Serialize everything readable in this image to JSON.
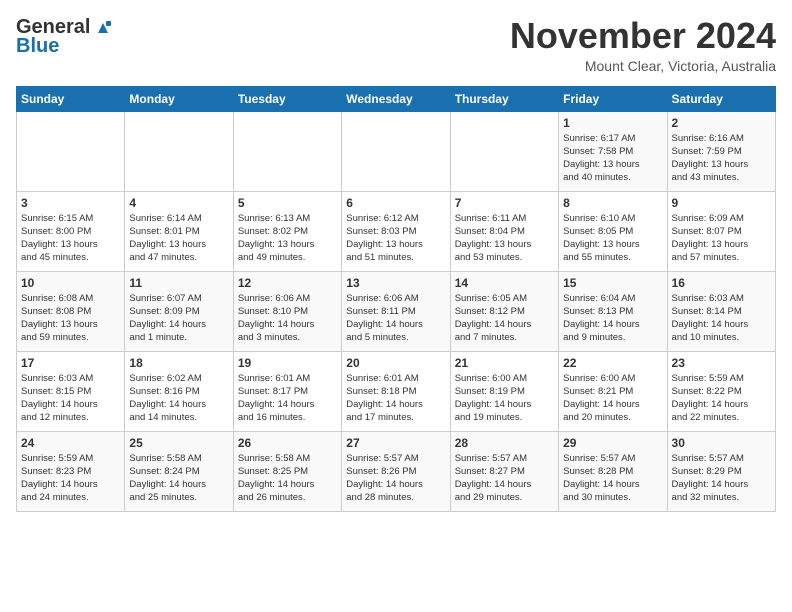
{
  "header": {
    "logo_line1": "General",
    "logo_line2": "Blue",
    "calendar_title": "November 2024",
    "calendar_subtitle": "Mount Clear, Victoria, Australia"
  },
  "weekdays": [
    "Sunday",
    "Monday",
    "Tuesday",
    "Wednesday",
    "Thursday",
    "Friday",
    "Saturday"
  ],
  "weeks": [
    [
      {
        "day": "",
        "info": ""
      },
      {
        "day": "",
        "info": ""
      },
      {
        "day": "",
        "info": ""
      },
      {
        "day": "",
        "info": ""
      },
      {
        "day": "",
        "info": ""
      },
      {
        "day": "1",
        "info": "Sunrise: 6:17 AM\nSunset: 7:58 PM\nDaylight: 13 hours\nand 40 minutes."
      },
      {
        "day": "2",
        "info": "Sunrise: 6:16 AM\nSunset: 7:59 PM\nDaylight: 13 hours\nand 43 minutes."
      }
    ],
    [
      {
        "day": "3",
        "info": "Sunrise: 6:15 AM\nSunset: 8:00 PM\nDaylight: 13 hours\nand 45 minutes."
      },
      {
        "day": "4",
        "info": "Sunrise: 6:14 AM\nSunset: 8:01 PM\nDaylight: 13 hours\nand 47 minutes."
      },
      {
        "day": "5",
        "info": "Sunrise: 6:13 AM\nSunset: 8:02 PM\nDaylight: 13 hours\nand 49 minutes."
      },
      {
        "day": "6",
        "info": "Sunrise: 6:12 AM\nSunset: 8:03 PM\nDaylight: 13 hours\nand 51 minutes."
      },
      {
        "day": "7",
        "info": "Sunrise: 6:11 AM\nSunset: 8:04 PM\nDaylight: 13 hours\nand 53 minutes."
      },
      {
        "day": "8",
        "info": "Sunrise: 6:10 AM\nSunset: 8:05 PM\nDaylight: 13 hours\nand 55 minutes."
      },
      {
        "day": "9",
        "info": "Sunrise: 6:09 AM\nSunset: 8:07 PM\nDaylight: 13 hours\nand 57 minutes."
      }
    ],
    [
      {
        "day": "10",
        "info": "Sunrise: 6:08 AM\nSunset: 8:08 PM\nDaylight: 13 hours\nand 59 minutes."
      },
      {
        "day": "11",
        "info": "Sunrise: 6:07 AM\nSunset: 8:09 PM\nDaylight: 14 hours\nand 1 minute."
      },
      {
        "day": "12",
        "info": "Sunrise: 6:06 AM\nSunset: 8:10 PM\nDaylight: 14 hours\nand 3 minutes."
      },
      {
        "day": "13",
        "info": "Sunrise: 6:06 AM\nSunset: 8:11 PM\nDaylight: 14 hours\nand 5 minutes."
      },
      {
        "day": "14",
        "info": "Sunrise: 6:05 AM\nSunset: 8:12 PM\nDaylight: 14 hours\nand 7 minutes."
      },
      {
        "day": "15",
        "info": "Sunrise: 6:04 AM\nSunset: 8:13 PM\nDaylight: 14 hours\nand 9 minutes."
      },
      {
        "day": "16",
        "info": "Sunrise: 6:03 AM\nSunset: 8:14 PM\nDaylight: 14 hours\nand 10 minutes."
      }
    ],
    [
      {
        "day": "17",
        "info": "Sunrise: 6:03 AM\nSunset: 8:15 PM\nDaylight: 14 hours\nand 12 minutes."
      },
      {
        "day": "18",
        "info": "Sunrise: 6:02 AM\nSunset: 8:16 PM\nDaylight: 14 hours\nand 14 minutes."
      },
      {
        "day": "19",
        "info": "Sunrise: 6:01 AM\nSunset: 8:17 PM\nDaylight: 14 hours\nand 16 minutes."
      },
      {
        "day": "20",
        "info": "Sunrise: 6:01 AM\nSunset: 8:18 PM\nDaylight: 14 hours\nand 17 minutes."
      },
      {
        "day": "21",
        "info": "Sunrise: 6:00 AM\nSunset: 8:19 PM\nDaylight: 14 hours\nand 19 minutes."
      },
      {
        "day": "22",
        "info": "Sunrise: 6:00 AM\nSunset: 8:21 PM\nDaylight: 14 hours\nand 20 minutes."
      },
      {
        "day": "23",
        "info": "Sunrise: 5:59 AM\nSunset: 8:22 PM\nDaylight: 14 hours\nand 22 minutes."
      }
    ],
    [
      {
        "day": "24",
        "info": "Sunrise: 5:59 AM\nSunset: 8:23 PM\nDaylight: 14 hours\nand 24 minutes."
      },
      {
        "day": "25",
        "info": "Sunrise: 5:58 AM\nSunset: 8:24 PM\nDaylight: 14 hours\nand 25 minutes."
      },
      {
        "day": "26",
        "info": "Sunrise: 5:58 AM\nSunset: 8:25 PM\nDaylight: 14 hours\nand 26 minutes."
      },
      {
        "day": "27",
        "info": "Sunrise: 5:57 AM\nSunset: 8:26 PM\nDaylight: 14 hours\nand 28 minutes."
      },
      {
        "day": "28",
        "info": "Sunrise: 5:57 AM\nSunset: 8:27 PM\nDaylight: 14 hours\nand 29 minutes."
      },
      {
        "day": "29",
        "info": "Sunrise: 5:57 AM\nSunset: 8:28 PM\nDaylight: 14 hours\nand 30 minutes."
      },
      {
        "day": "30",
        "info": "Sunrise: 5:57 AM\nSunset: 8:29 PM\nDaylight: 14 hours\nand 32 minutes."
      }
    ]
  ]
}
